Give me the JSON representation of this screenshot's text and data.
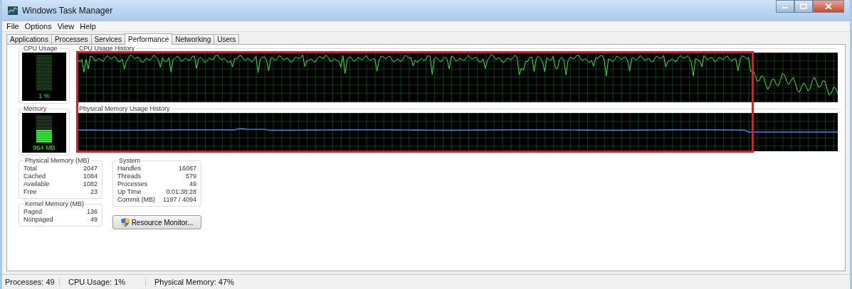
{
  "window": {
    "title": "Windows Task Manager"
  },
  "menu": [
    "File",
    "Options",
    "View",
    "Help"
  ],
  "tabs": [
    {
      "label": "Applications",
      "selected": false
    },
    {
      "label": "Processes",
      "selected": false
    },
    {
      "label": "Services",
      "selected": false
    },
    {
      "label": "Performance",
      "selected": true
    },
    {
      "label": "Networking",
      "selected": false
    },
    {
      "label": "Users",
      "selected": false
    }
  ],
  "cpu_usage": {
    "label": "CPU Usage",
    "reading": "1 %",
    "level": 0.01
  },
  "cpu_history": {
    "label": "CPU Usage History"
  },
  "memory": {
    "label": "Memory",
    "reading": "964 MB",
    "level": 0.47
  },
  "memory_history": {
    "label": "Physical Memory Usage History"
  },
  "physical_memory": {
    "title": "Physical Memory (MB)",
    "rows": [
      {
        "label": "Total",
        "value": "2047"
      },
      {
        "label": "Cached",
        "value": "1084"
      },
      {
        "label": "Available",
        "value": "1082"
      },
      {
        "label": "Free",
        "value": "23"
      }
    ]
  },
  "kernel_memory": {
    "title": "Kernel Memory (MB)",
    "rows": [
      {
        "label": "Paged",
        "value": "136"
      },
      {
        "label": "Nonpaged",
        "value": "49"
      }
    ]
  },
  "system": {
    "title": "System",
    "rows": [
      {
        "label": "Handles",
        "value": "16087"
      },
      {
        "label": "Threads",
        "value": "579"
      },
      {
        "label": "Processes",
        "value": "49"
      },
      {
        "label": "Up Time",
        "value": "0:01:38:28"
      },
      {
        "label": "Commit (MB)",
        "value": "1197 / 4094"
      }
    ]
  },
  "resource_monitor_button": "Resource Monitor...",
  "status_bar": [
    "Processes: 49",
    "CPU Usage: 1%",
    "Physical Memory: 47%"
  ]
}
